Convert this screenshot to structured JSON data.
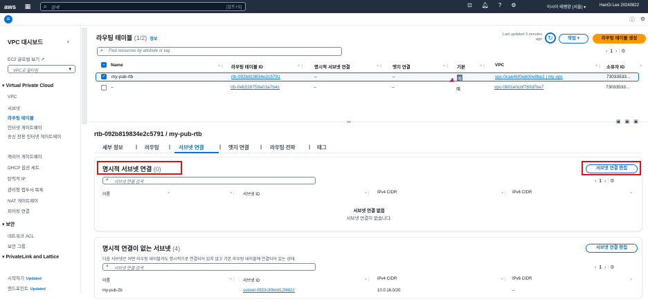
{
  "topbar": {
    "logo": "aws",
    "search_placeholder": "검색",
    "search_shortcut": "[알트+S]",
    "region": "아시아 태평양 (서울) ▾",
    "user": "HanGi Lee 20240822"
  },
  "sidebar": {
    "title": "VPC 대시보드",
    "global_view": "EC2 글로벌 보기 ↗",
    "filter_placeholder": "VPC로 필터링",
    "sections": [
      {
        "label": "Virtual Private Cloud"
      },
      {
        "label": "보안"
      },
      {
        "label": "PrivateLink and Lattice"
      }
    ],
    "items_vpc": [
      "VPC",
      "서브넷",
      "라우팅 테이블",
      "인터넷 게이트웨이",
      "송신 전용 인터넷 게이트웨이",
      "캐리어 게이트웨이",
      "DHCP 옵션 세트",
      "탄력적 IP",
      "관리형 접두사 목록",
      "NAT 게이트웨이",
      "피어링 연결"
    ],
    "items_security": [
      "네트워크 ACL",
      "보안 그룹"
    ],
    "items_privatelink": [
      {
        "label": "시작하기",
        "badge": "Updated"
      },
      {
        "label": "엔드포인트",
        "badge": "Updated"
      }
    ]
  },
  "main": {
    "title": "라우팅 테이블",
    "count": "(1/2)",
    "info": "정보",
    "last_updated": "Last updated 3 minutes ago",
    "actions_label": "작업 ▾",
    "create_label": "라우팅 테이블 생성",
    "filter_placeholder": "Find resources by attribute or tag",
    "page": "1",
    "columns": [
      "Name",
      "라우팅 테이블 ID",
      "명시적 서브넷 연결",
      "엣지 연결",
      "기본",
      "VPC",
      "소유자 ID"
    ],
    "rows": [
      {
        "name": "my-pub-rtb",
        "id": "rtb-092b819834e2c5791",
        "explicit": "–",
        "edge": "–",
        "main": "예",
        "vpc": "vpc-0cae4bf0eb00e8be2 | my-vpc",
        "owner": "73033533..."
      },
      {
        "name": "–",
        "id": "rtb-0eb228759a03a7b4c",
        "explicit": "–",
        "edge": "–",
        "main": "예",
        "vpc": "vpc-0801e0cbf780d7be7",
        "owner": "73033533..."
      }
    ]
  },
  "detail": {
    "title": "rtb-092b819834e2c5791 / my-pub-rtb",
    "tabs": [
      "세부 정보",
      "라우팅",
      "서브넷 연결",
      "엣지 연결",
      "라우팅 전파",
      "태그"
    ],
    "explicit_box": {
      "title": "명시적 서브넷 연결",
      "count": "(0)",
      "edit_label": "서브넷 연결 편집",
      "search_placeholder": "서브넷 연결 검색",
      "page": "1",
      "columns": [
        "이름",
        "서브넷 ID",
        "IPv4 CIDR",
        "IPv6 CIDR"
      ],
      "empty_title": "서브넷 연결 없음",
      "empty_desc": "서브넷 연결이 없습니다."
    },
    "implicit_box": {
      "title": "명시적 연결이 없는 서브넷",
      "count": "(4)",
      "edit_label": "서브넷 연결 편집",
      "desc": "다음 서브넷은 어떤 라우팅 테이블과도 명시적으로 연결되어 있지 않고 기본 라우팅 테이블에 연결되어 있는 상태:",
      "search_placeholder": "서브넷 연결 검색",
      "page": "1",
      "columns": [
        "이름",
        "서브넷 ID",
        "IPv4 CIDR",
        "IPv6 CIDR"
      ],
      "rows": [
        {
          "name": "my-pub-2b",
          "subnet": "subnet-0833c80bb812f4822",
          "ipv4": "10.0.16.0/20",
          "ipv6": "–"
        }
      ]
    }
  },
  "colors": {
    "topbar": "#232f3e",
    "link": "#0972d3",
    "primary": "#ff9900",
    "highlight": "#d91515"
  }
}
